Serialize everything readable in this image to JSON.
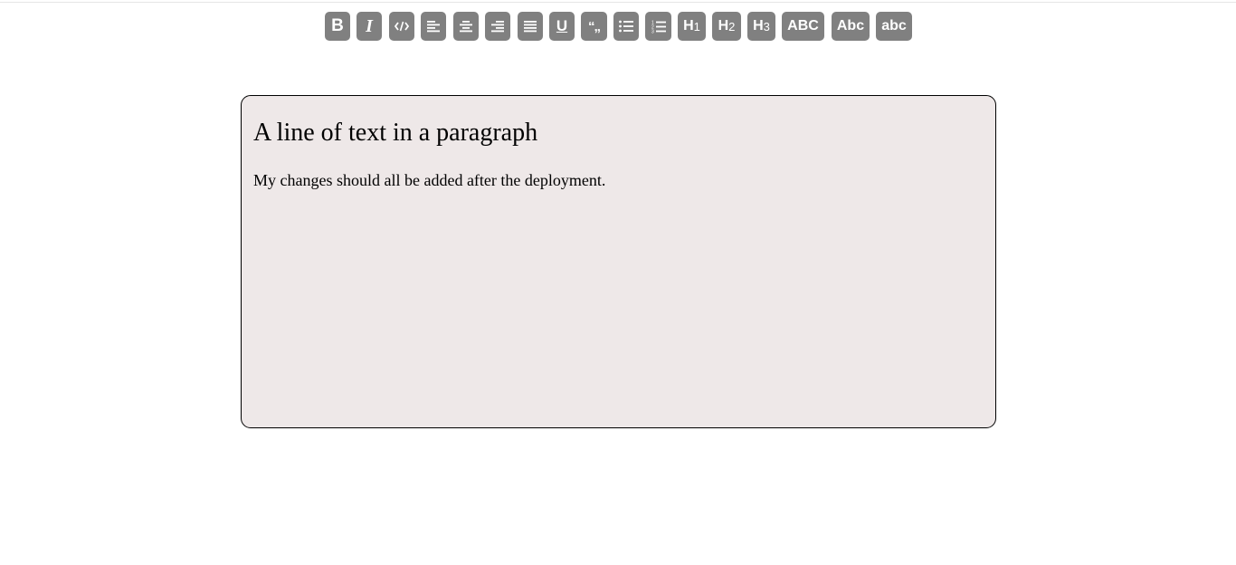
{
  "toolbar": {
    "buttons": [
      {
        "name": "bold-button",
        "icon": "bold-icon",
        "label": "B"
      },
      {
        "name": "italic-button",
        "icon": "italic-icon",
        "label": "I"
      },
      {
        "name": "code-button",
        "icon": "code-icon",
        "label": ""
      },
      {
        "name": "align-left-button",
        "icon": "align-left-icon",
        "label": ""
      },
      {
        "name": "align-center-button",
        "icon": "align-center-icon",
        "label": ""
      },
      {
        "name": "align-right-button",
        "icon": "align-right-icon",
        "label": ""
      },
      {
        "name": "align-justify-button",
        "icon": "align-justify-icon",
        "label": ""
      },
      {
        "name": "underline-button",
        "icon": "underline-icon",
        "label": "U"
      },
      {
        "name": "blockquote-button",
        "icon": "quote-icon",
        "label": "“„"
      },
      {
        "name": "bullet-list-button",
        "icon": "bullet-list-icon",
        "label": ""
      },
      {
        "name": "numbered-list-button",
        "icon": "numbered-list-icon",
        "label": ""
      }
    ],
    "heading_buttons": [
      {
        "letter": "H",
        "num": "1"
      },
      {
        "letter": "H",
        "num": "2"
      },
      {
        "letter": "H",
        "num": "3"
      }
    ],
    "case_buttons": {
      "upper": "ABC",
      "title": "Abc",
      "lower": "abc"
    }
  },
  "editor": {
    "heading": "A line of text in a paragraph",
    "paragraph": "My changes should all be added after the deployment."
  },
  "colors": {
    "button_bg": "#808080",
    "editor_bg": "#eee8e8",
    "editor_border": "#000000"
  }
}
